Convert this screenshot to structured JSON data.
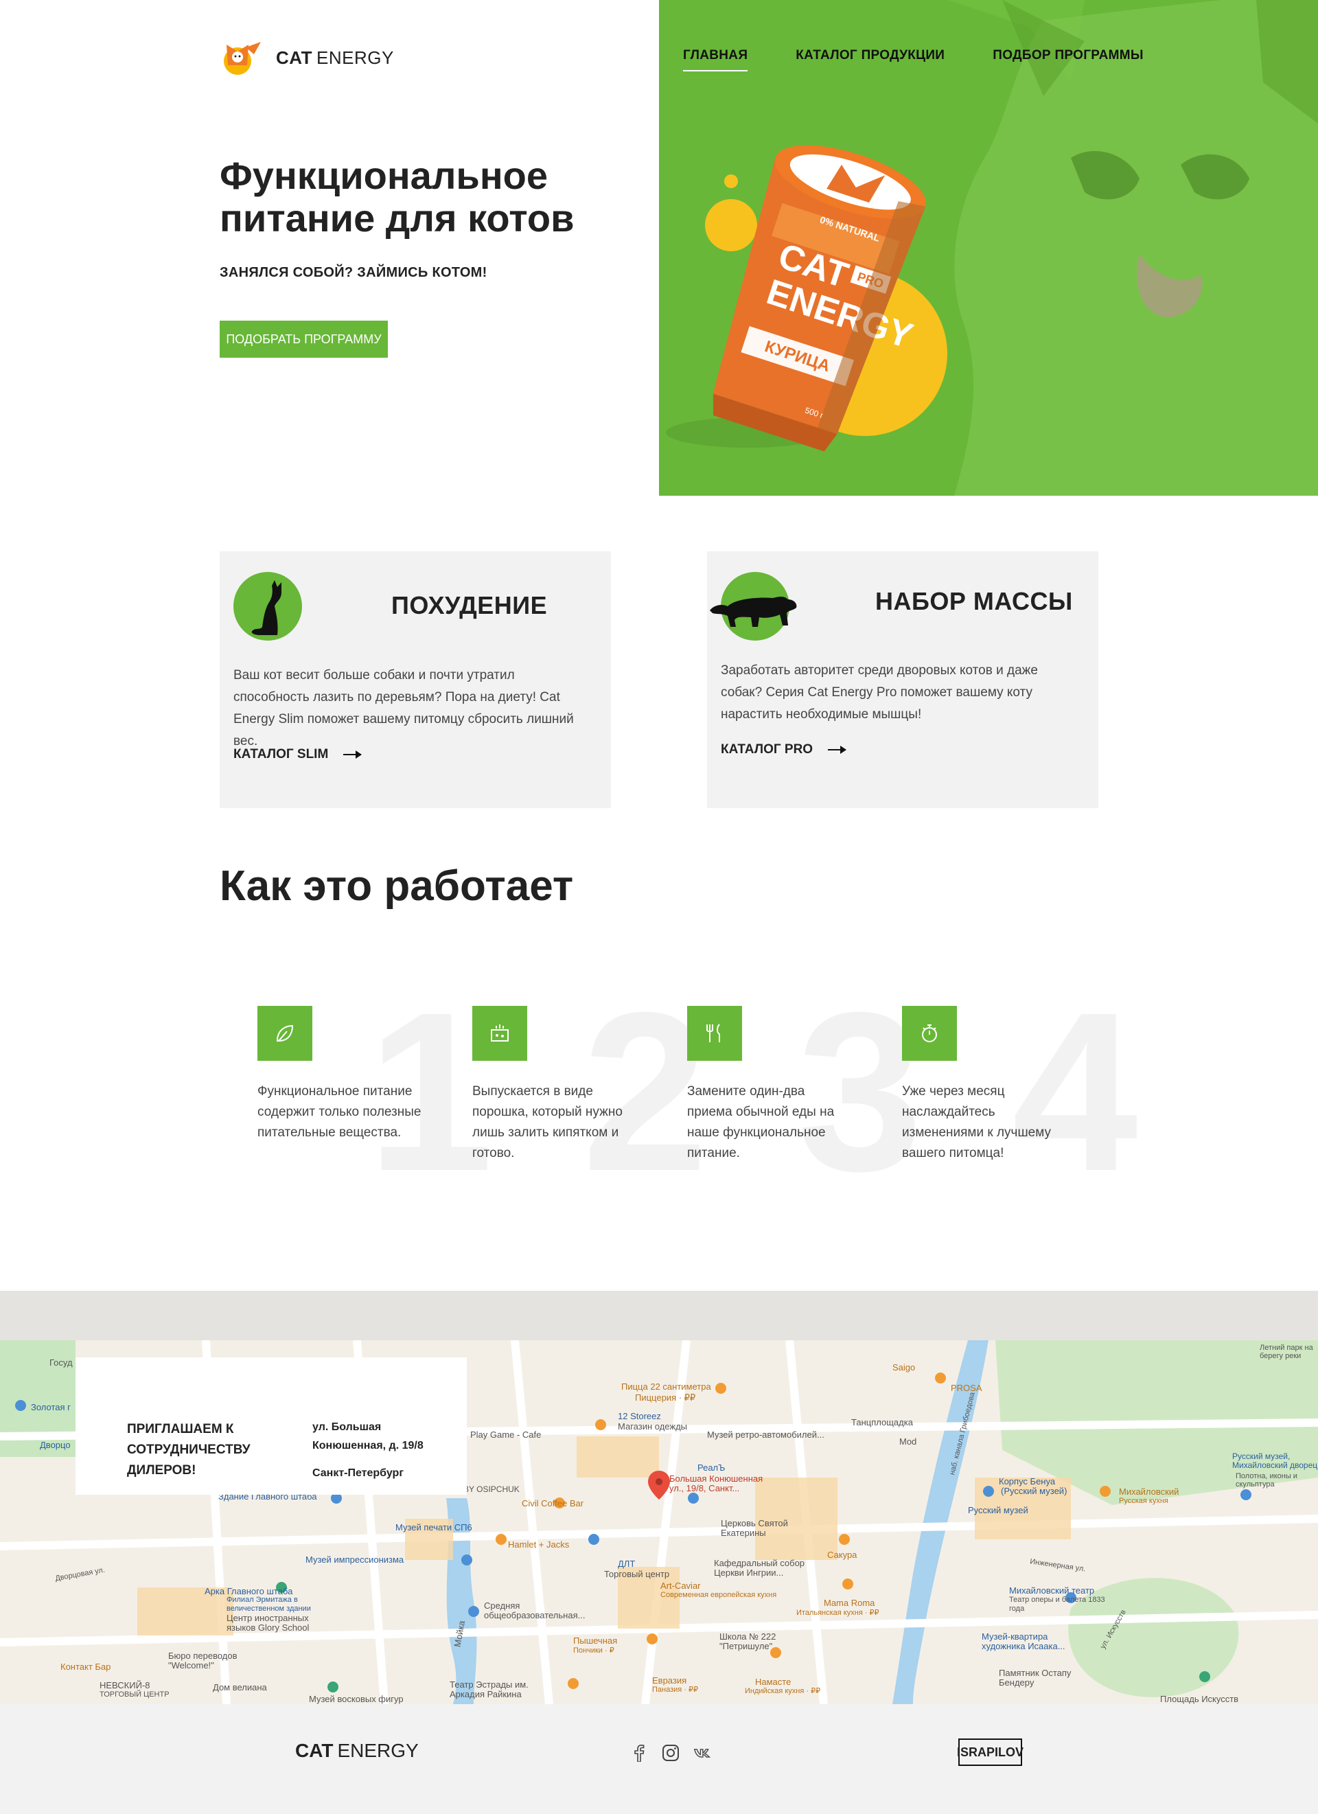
{
  "brand": {
    "name_bold": "CAT",
    "name_regular": "ENERGY",
    "accent": "#68b738"
  },
  "nav": {
    "items": [
      {
        "label": "ГЛАВНАЯ",
        "active": true
      },
      {
        "label": "КАТАЛОГ ПРОДУКЦИИ"
      },
      {
        "label": "ПОДБОР ПРОГРАММЫ"
      }
    ]
  },
  "hero": {
    "title": "Функциональное питание для котов",
    "subtitle": "ЗАНЯЛСЯ СОБОЙ? ЗАЙМИСЬ КОТОМ!",
    "button": "ПОДОБРАТЬ ПРОГРАММУ",
    "product": {
      "badge": "0% NATURAL",
      "brand_line1": "CAT",
      "brand_line2": "ENERGY",
      "pro": "PRO",
      "flavor": "КУРИЦА",
      "weight": "500 г"
    }
  },
  "cards": [
    {
      "title": "ПОХУДЕНИЕ",
      "text": "Ваш кот весит больше собаки и почти утратил способность лазить по деревьям? Пора на диету! Cat Energy Slim поможет вашему питомцу сбросить лишний вес.",
      "link": "КАТАЛОГ SLIM",
      "icon": "sitting-cat-icon"
    },
    {
      "title": "НАБОР МАССЫ",
      "text": "Заработать авторитет среди дворовых котов и даже собак? Серия Cat Energy Pro поможет вашему коту нарастить необходимые мышцы!",
      "link": "КАТАЛОГ PRO",
      "icon": "panther-icon"
    }
  ],
  "how": {
    "title": "Как это работает",
    "steps": [
      {
        "num": "1",
        "icon": "leaf-icon",
        "text": "Функциональное питание содержит только полезные питательные вещества."
      },
      {
        "num": "2",
        "icon": "cup-icon",
        "text": "Выпускается в виде порошка, который нужно лишь залить кипятком и готово."
      },
      {
        "num": "3",
        "icon": "cutlery-icon",
        "text": "Замените один-два приема обычной еды на наше функциональное питание."
      },
      {
        "num": "4",
        "icon": "stopwatch-icon",
        "text": "Уже через месяц наслаждайтесь изменениями к лучшему вашего питомца!"
      }
    ]
  },
  "map": {
    "card_title": "ПРИГЛАШАЕМ К СОТРУДНИЧЕСТВУ ДИЛЕРОВ!",
    "address": "ул. Большая Конюшенная, д. 19/8",
    "city": "Санкт-Петербург",
    "labels": [
      "Пицца 22 сантиметра",
      "Пиццерия · ₽₽",
      "12 Storeez",
      "Магазин одежды",
      "Музей ретро-автомобилей...",
      "Танцплощадка",
      "Mod",
      "Saigo",
      "PROSA",
      "Play Game - Cafe",
      "РеалЪ",
      "Большая Конюшенная ул., 19/8, Санкт...",
      "Civil Coffee Bar",
      "Hamlet + Jacks",
      "ДЛТ",
      "Торговый центр",
      "Церковь Святой Екатерины",
      "Кафедральный собор Церкви Ингрии...",
      "Сакура",
      "Art-Caviar",
      "Современная европейская кухня",
      "Mama Roma",
      "Итальянская кухня · ₽₽",
      "Средняя общеобразовательная...",
      "Пышечная",
      "Пончики · ₽",
      "Школа № 222 \"Петришуле\"",
      "Евразия",
      "Паназия · ₽₽",
      "Намасте",
      "Индийская кухня · ₽₽",
      "Театр Эстрады им. Аркадия Райкина",
      "Музей восковых фигур",
      "Дом велиана",
      "Бюро переводов \"Welcome!\"",
      "Контакт Бар",
      "НЕВСКИЙ-8",
      "ТОРГОВЫЙ ЦЕНТР",
      "Центр иностранных языков Glory School",
      "Арка Главного штаба",
      "Филиал Эрмитажа в величественном здании",
      "Музей импрессионизма",
      "Музей печати СП6",
      "Здание Главного штаба",
      "Золотая г",
      "Дворцо",
      "Госуд",
      "BY OSIPCHUK",
      "Корпус Бенуа",
      "(Русский музей)",
      "Русский музей",
      "Михайловский",
      "Русская кухня",
      "Михайловский театр",
      "Театр оперы и балета 1833 года",
      "Музей-квартира художника Исаака...",
      "Памятник Остапу Бендеру",
      "Площадь Искусств",
      "Русский музей, Михайловский дворец",
      "Полотна, иконы и скульптура",
      "Мойка",
      "Инженерная ул.",
      "ул. Искусств",
      "наб. канала Грибоедова",
      "Дворцовая ул.",
      "Летний парк на берегу реки"
    ]
  },
  "footer": {
    "logo_bold": "CAT",
    "logo_regular": "ENERGY",
    "socials": [
      "facebook-icon",
      "instagram-icon",
      "vk-icon"
    ],
    "author": "ISRAPILOV"
  }
}
